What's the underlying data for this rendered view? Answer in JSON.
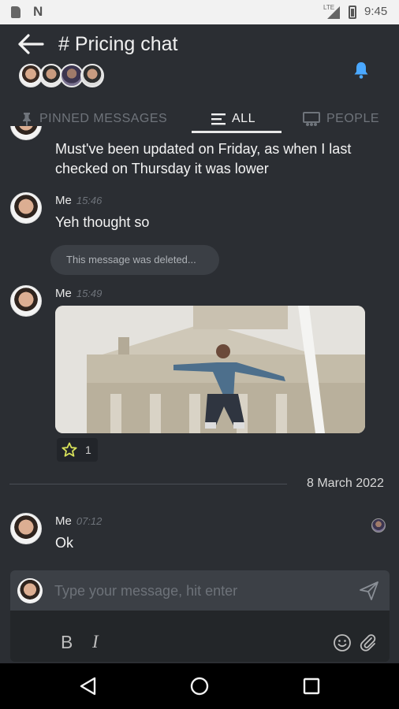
{
  "status_bar": {
    "network_label": "LTE",
    "time": "9:45"
  },
  "header": {
    "title": "# Pricing chat",
    "tabs": [
      {
        "label": "PINNED MESSAGES",
        "icon": "pin-icon"
      },
      {
        "label": "ALL",
        "icon": "list-icon"
      },
      {
        "label": "PEOPLE",
        "icon": "people-icon"
      }
    ],
    "active_tab": "ALL",
    "accent_color": "#4aa8ff"
  },
  "messages": [
    {
      "author": "",
      "time": "",
      "text": "Must've been updated on Friday, as when I last checked on Thursday it was lower"
    },
    {
      "author": "Me",
      "time": "15:46",
      "text": "Yeh thought so"
    },
    {
      "deleted_notice": "This message was deleted..."
    },
    {
      "author": "Me",
      "time": "15:49",
      "attachment": "gif",
      "reaction": {
        "icon": "star-icon",
        "count": "1"
      }
    },
    {
      "date_separator": "8 March 2022"
    },
    {
      "author": "Me",
      "time": "07:12",
      "text": "Ok"
    }
  ],
  "composer": {
    "placeholder": "Type your message, hit enter",
    "bold_label": "B",
    "italic_label": "I"
  },
  "colors": {
    "background": "#2b2e33",
    "bubble": "#3b3f45",
    "star": "#d6e05a"
  }
}
